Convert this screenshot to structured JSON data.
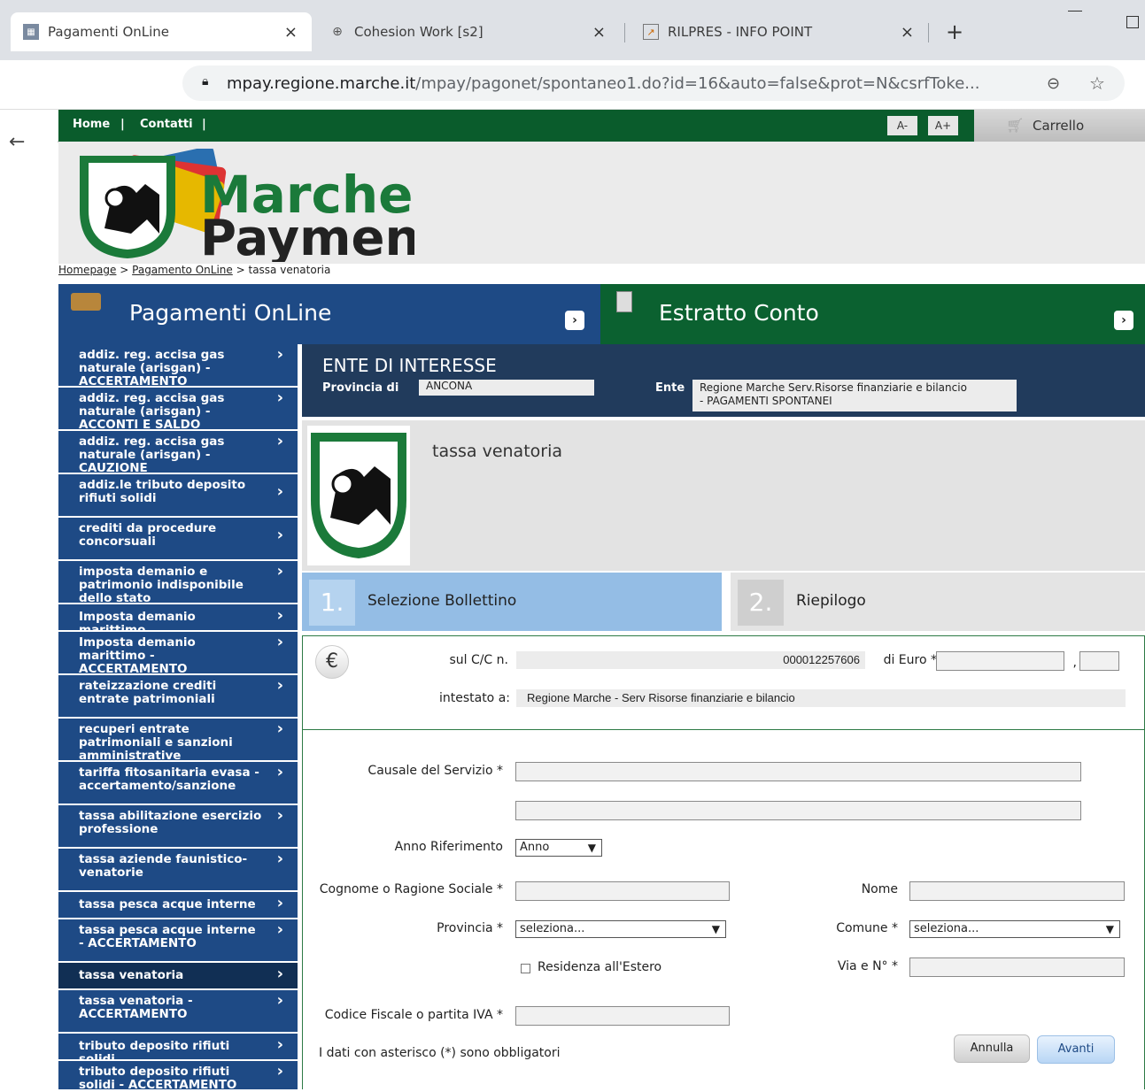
{
  "browser": {
    "tabs": [
      {
        "title": "Pagamenti OnLine",
        "close": "×"
      },
      {
        "title": "Cohesion Work [s2]",
        "close": "×"
      },
      {
        "title": "RILPRES - INFO POINT",
        "close": "×"
      }
    ],
    "new_tab": "+",
    "url_host": "mpay.regione.marche.it",
    "url_path": "/mpay/pagonet/spontaneo1.do?id=16&auto=false&prot=N&csrfToke..."
  },
  "topnav": {
    "home": "Home",
    "sep1": "|",
    "contatti": "Contatti",
    "sep2": "|",
    "font_minus": "A-",
    "font_plus": "A+",
    "cart": "Carrello"
  },
  "logo": {
    "line1": "Marche",
    "line2": "Payment"
  },
  "breadcrumb": {
    "home": "Homepage",
    "sep": ">",
    "pagamento": "Pagamento OnLine",
    "current": "tassa venatoria"
  },
  "banner": {
    "pagamenti": "Pagamenti OnLine",
    "estratto": "Estratto Conto",
    "arrow": "›"
  },
  "sidebar": {
    "items": [
      {
        "label": "addiz. reg. accisa gas naturale (arisgan) - ACCERTAMENTO"
      },
      {
        "label": "addiz. reg. accisa gas naturale (arisgan) - ACCONTI E SALDO"
      },
      {
        "label": "addiz. reg. accisa gas naturale (arisgan) - CAUZIONE"
      },
      {
        "label": "addiz.le tributo deposito rifiuti solidi"
      },
      {
        "label": "crediti da procedure concorsuali"
      },
      {
        "label": "imposta demanio e patrimonio indisponibile dello stato"
      },
      {
        "label": "Imposta demanio marittimo"
      },
      {
        "label": "Imposta demanio marittimo - ACCERTAMENTO"
      },
      {
        "label": "rateizzazione crediti entrate patrimoniali"
      },
      {
        "label": "recuperi entrate patrimoniali e sanzioni amministrative"
      },
      {
        "label": "tariffa fitosanitaria evasa - accertamento/sanzione"
      },
      {
        "label": "tassa abilitazione esercizio professione"
      },
      {
        "label": "tassa aziende faunistico-venatorie"
      },
      {
        "label": "tassa pesca acque interne"
      },
      {
        "label": "tassa pesca acque interne - ACCERTAMENTO"
      },
      {
        "label": "tassa venatoria"
      },
      {
        "label": "tassa venatoria - ACCERTAMENTO"
      },
      {
        "label": "tributo deposito rifiuti solidi"
      },
      {
        "label": "tributo deposito rifiuti solidi - ACCERTAMENTO"
      }
    ],
    "chevron": "›"
  },
  "ente": {
    "title": "ENTE DI INTERESSE",
    "provincia_label": "Provincia di",
    "provincia_value": "ANCONA",
    "ente_label": "Ente",
    "ente_value1": "Regione Marche Serv.Risorse finanziarie e bilancio",
    "ente_value2": "- PAGAMENTI SPONTANEI"
  },
  "service": {
    "title": "tassa venatoria"
  },
  "steps": [
    {
      "num": "1.",
      "label": "Selezione Bollettino"
    },
    {
      "num": "2.",
      "label": "Riepilogo"
    }
  ],
  "cc": {
    "euro_symbol": "€",
    "cc_label": "sul C/C n.",
    "cc_value": "000012257606",
    "euro_label": "di Euro *",
    "comma": ",",
    "intestato_label": "intestato a:",
    "intestato_value": "Regione Marche - Serv Risorse finanziarie e bilancio"
  },
  "form": {
    "causale_label": "Causale del Servizio *",
    "anno_label": "Anno Riferimento",
    "anno_value": "Anno",
    "cognome_label": "Cognome o Ragione Sociale *",
    "nome_label": "Nome",
    "provincia_label": "Provincia *",
    "provincia_value": "seleziona...",
    "comune_label": "Comune *",
    "comune_value": "seleziona...",
    "residenza_label": "Residenza all'Estero",
    "via_label": "Via e N° *",
    "cf_label": "Codice Fiscale o partita IVA *",
    "note": "I dati con asterisco (*) sono obbligatori",
    "annulla": "Annulla",
    "avanti": "Avanti"
  },
  "colors": {
    "green": "#0b6130",
    "blue": "#1e4a85",
    "navy": "#213b5c",
    "step_active": "#94bde5"
  }
}
